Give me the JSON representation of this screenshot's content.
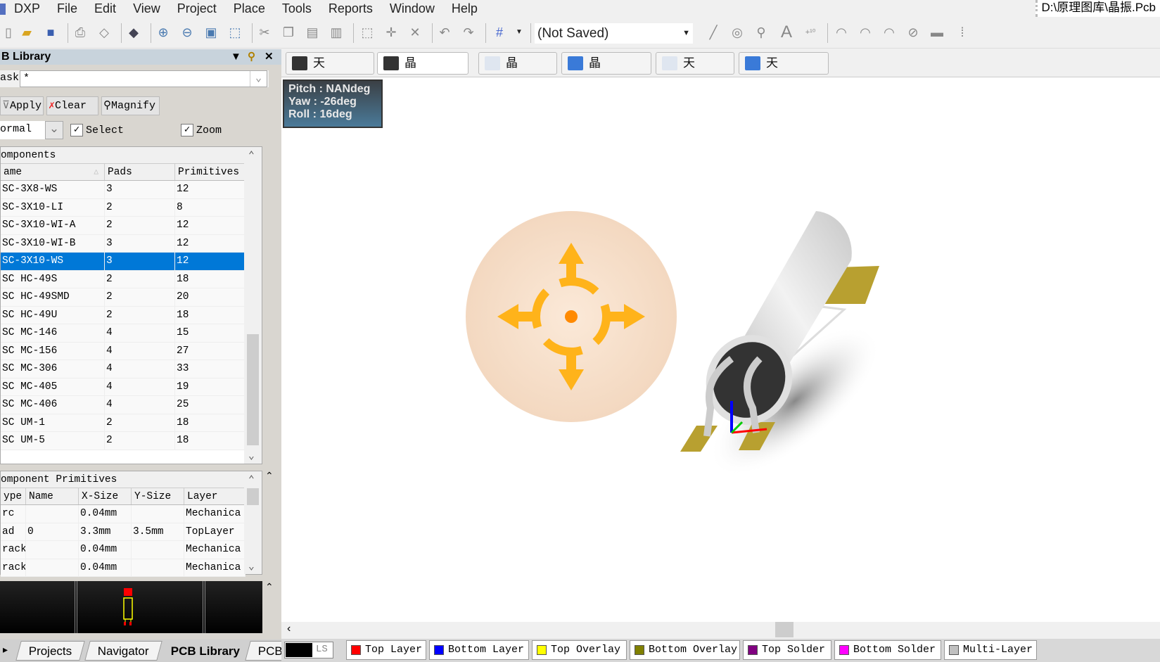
{
  "menubar": {
    "app": "DXP",
    "items": [
      "File",
      "Edit",
      "View",
      "Project",
      "Place",
      "Tools",
      "Reports",
      "Window",
      "Help"
    ],
    "path": "D:\\原理图库\\晶振.Pcb"
  },
  "toolbar": {
    "config": "(Not Saved)"
  },
  "panel": {
    "title": "B Library",
    "mask_label": "ask",
    "mask_value": "*",
    "buttons": {
      "apply": "Apply",
      "clear": "Clear",
      "magnify": "Magnify"
    },
    "mode": "ormal",
    "select_label": "Select",
    "select_checked": true,
    "zoom_label": "Zoom",
    "zoom_checked": true,
    "components": {
      "title": "omponents",
      "columns": [
        "ame",
        "Pads",
        "Primitives"
      ],
      "rows": [
        [
          "SC-3X8-WS",
          "3",
          "12"
        ],
        [
          "SC-3X10-LI",
          "2",
          "8"
        ],
        [
          "SC-3X10-WI-A",
          "2",
          "12"
        ],
        [
          "SC-3X10-WI-B",
          "3",
          "12"
        ],
        [
          "SC-3X10-WS",
          "3",
          "12"
        ],
        [
          "SC HC-49S",
          "2",
          "18"
        ],
        [
          "SC HC-49SMD",
          "2",
          "20"
        ],
        [
          "SC HC-49U",
          "2",
          "18"
        ],
        [
          "SC MC-146",
          "4",
          "15"
        ],
        [
          "SC MC-156",
          "4",
          "27"
        ],
        [
          "SC MC-306",
          "4",
          "33"
        ],
        [
          "SC MC-405",
          "4",
          "19"
        ],
        [
          "SC MC-406",
          "4",
          "25"
        ],
        [
          "SC UM-1",
          "2",
          "18"
        ],
        [
          "SC UM-5",
          "2",
          "18"
        ]
      ],
      "selected_index": 4
    },
    "primitives": {
      "title": "omponent Primitives",
      "columns": [
        "ype",
        "Name",
        "X-Size",
        "Y-Size",
        "Layer"
      ],
      "rows": [
        [
          "rc",
          "",
          "0.04mm",
          "",
          "Mechanica"
        ],
        [
          "ad",
          "0",
          "3.3mm",
          "3.5mm",
          "TopLayer"
        ],
        [
          "rack",
          "",
          "0.04mm",
          "",
          "Mechanica"
        ],
        [
          "rack",
          "",
          "0.04mm",
          "",
          "Mechanica"
        ]
      ]
    },
    "bottom_tabs": [
      "Projects",
      "Navigator",
      "PCB Library",
      "PCB"
    ],
    "active_bottom_tab": "PCB Library"
  },
  "doc_tabs": [
    {
      "label": "天线.PcbLib",
      "icon": "pcblib-icon"
    },
    {
      "label": "晶振.PcbLib",
      "icon": "pcblib-icon",
      "active": true
    },
    {
      "label": "晶振.REP",
      "icon": "document-icon"
    },
    {
      "label": "晶振.PcbLib",
      "icon": "ie-document-icon"
    },
    {
      "label": "天线.REP",
      "icon": "document-icon"
    },
    {
      "label": "天线.PcbLib",
      "icon": "ie-document-icon"
    }
  ],
  "hud": {
    "pitch": "Pitch : NANdeg",
    "yaw": "Yaw : -26deg",
    "roll": "Roll : 16deg"
  },
  "layers": {
    "ls": "LS",
    "items": [
      {
        "label": "Top Layer",
        "color": "#ff0000"
      },
      {
        "label": "Bottom Layer",
        "color": "#0000ff"
      },
      {
        "label": "Top Overlay",
        "color": "#ffff00"
      },
      {
        "label": "Bottom Overlay",
        "color": "#808000"
      },
      {
        "label": "Top Solder",
        "color": "#800080"
      },
      {
        "label": "Bottom Solder",
        "color": "#ff00ff"
      },
      {
        "label": "Multi-Layer",
        "color": "#c0c0c0"
      }
    ]
  }
}
